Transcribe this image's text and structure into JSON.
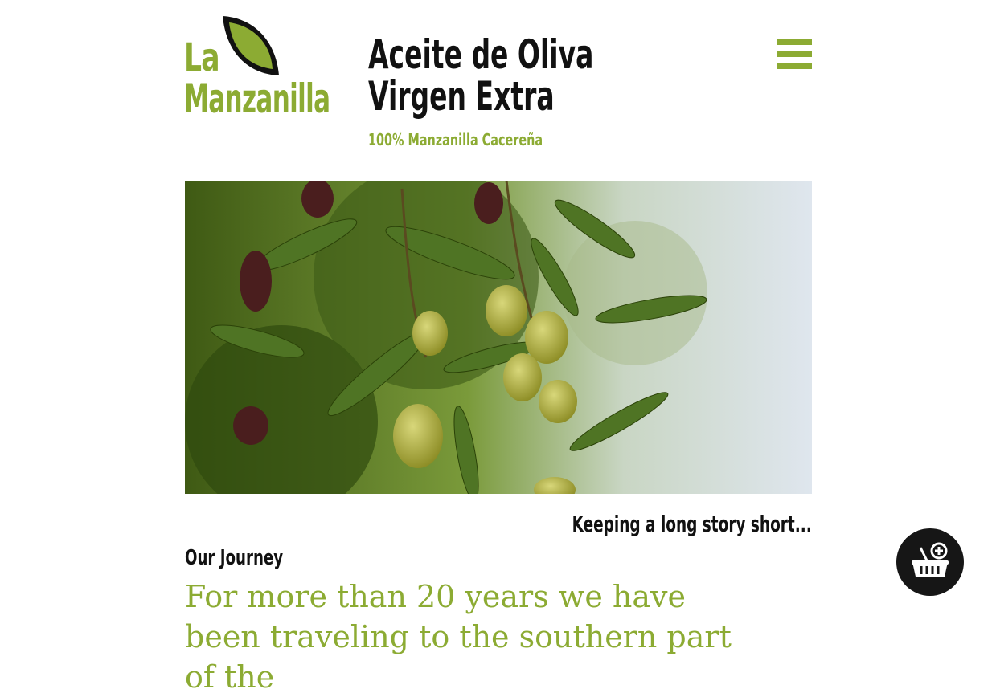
{
  "brand": {
    "line1": "La",
    "line2": "Manzanilla",
    "logo_icon": "leaf-icon",
    "color": "#8cab33"
  },
  "header": {
    "tagline_line1": "Aceite de Oliva",
    "tagline_line2": "Virgen Extra",
    "subtitle": "100% Manzanilla Cacereña",
    "menu_icon": "hamburger-menu-icon"
  },
  "hero": {
    "image": "olive-branch-photo"
  },
  "content": {
    "story_heading": "Keeping a long story short...",
    "section_title": "Our Journey",
    "lead_text": "For more than 20 years we have been traveling to the southern part of the"
  },
  "cart": {
    "icon": "basket-add-icon"
  },
  "colors": {
    "accent": "#8cab33",
    "text": "#111111",
    "background": "#ffffff",
    "fab": "#161616"
  }
}
